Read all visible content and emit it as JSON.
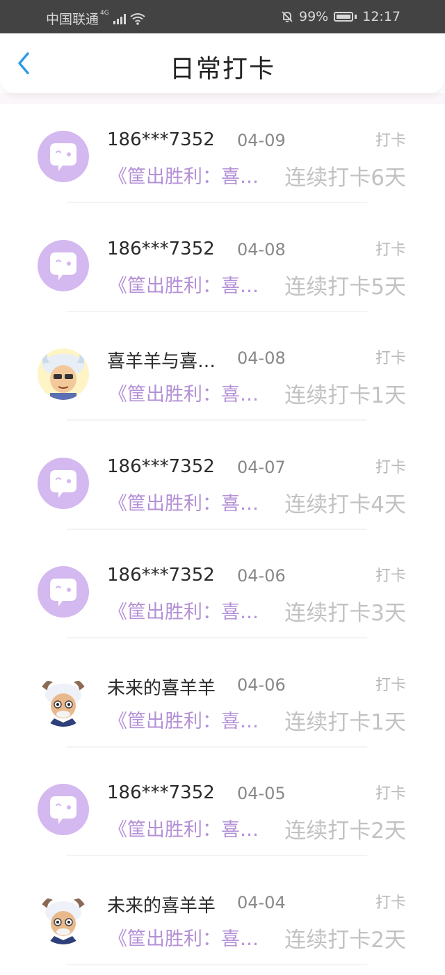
{
  "status": {
    "carrier": "中国联通",
    "network": "4G",
    "battery": "99%",
    "time": "12:17"
  },
  "header": {
    "title": "日常打卡"
  },
  "checkins": [
    {
      "name": "186***7352",
      "date": "04-09",
      "action": "打卡",
      "book": "《筐出胜利：喜羊羊与灰太狼》",
      "streak": "连续打卡6天",
      "avatar": "default-avatar"
    },
    {
      "name": "186***7352",
      "date": "04-08",
      "action": "打卡",
      "book": "《筐出胜利：喜羊羊与灰太狼》",
      "streak": "连续打卡5天",
      "avatar": "default-avatar"
    },
    {
      "name": "喜羊羊与喜羊羊",
      "date": "04-08",
      "action": "打卡",
      "book": "《筐出胜利：喜羊羊与灰太狼》",
      "streak": "连续打卡1天",
      "avatar": "cartoon-goat-avatar"
    },
    {
      "name": "186***7352",
      "date": "04-07",
      "action": "打卡",
      "book": "《筐出胜利：喜羊羊与灰太狼》",
      "streak": "连续打卡4天",
      "avatar": "default-avatar"
    },
    {
      "name": "186***7352",
      "date": "04-06",
      "action": "打卡",
      "book": "《筐出胜利：喜羊羊与灰太狼》",
      "streak": "连续打卡3天",
      "avatar": "default-avatar"
    },
    {
      "name": "未来的喜羊羊",
      "date": "04-06",
      "action": "打卡",
      "book": "《筐出胜利：喜羊羊与灰太狼》",
      "streak": "连续打卡1天",
      "avatar": "old-goat-avatar"
    },
    {
      "name": "186***7352",
      "date": "04-05",
      "action": "打卡",
      "book": "《筐出胜利：喜羊羊与灰太狼》",
      "streak": "连续打卡2天",
      "avatar": "default-avatar"
    },
    {
      "name": "未来的喜羊羊",
      "date": "04-04",
      "action": "打卡",
      "book": "《筐出胜利：喜羊羊与灰太狼》",
      "streak": "连续打卡2天",
      "avatar": "old-goat-avatar"
    }
  ],
  "colors": {
    "status_bar": "#434343",
    "accent_blue": "#2d9ae8",
    "book_purple": "#b491d6",
    "avatar_purple": "#d4b8f0"
  }
}
